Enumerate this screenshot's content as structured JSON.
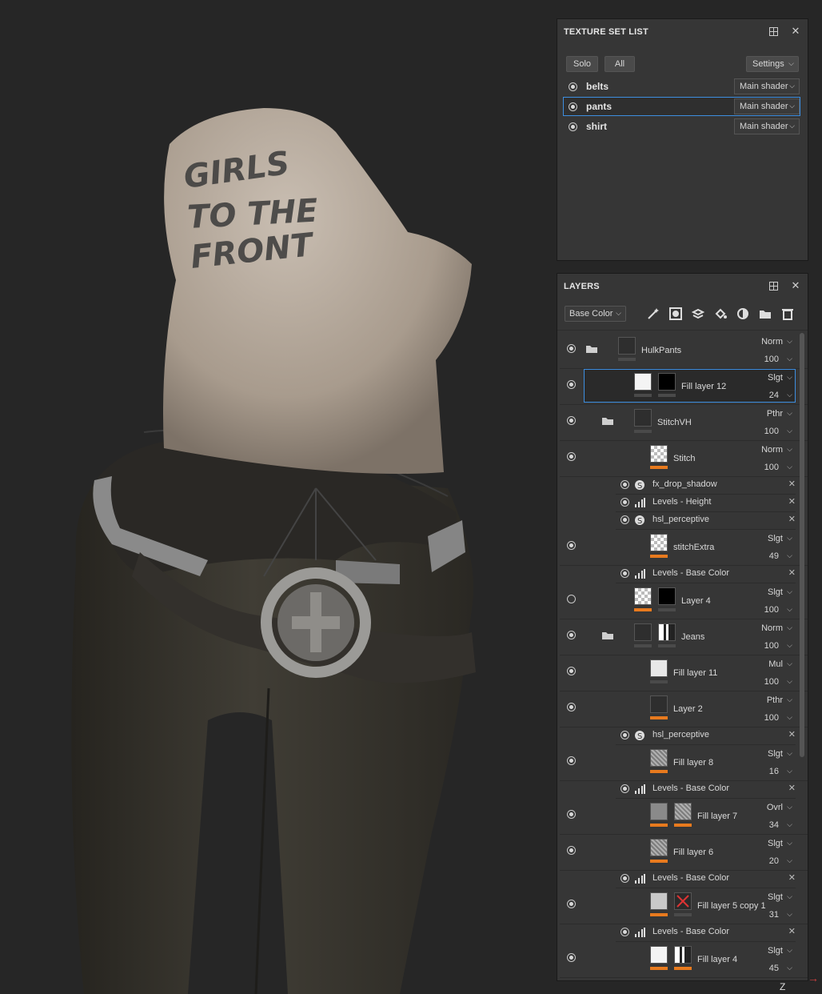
{
  "viewport": {
    "shirt_print_lines": [
      "GIRLS",
      "TO THE",
      "FRONT"
    ]
  },
  "texture_set_list": {
    "title": "TEXTURE SET LIST",
    "solo_label": "Solo",
    "all_label": "All",
    "settings_label": "Settings",
    "sets": [
      {
        "name": "belts",
        "shader": "Main shader",
        "selected": false
      },
      {
        "name": "pants",
        "shader": "Main shader",
        "selected": true
      },
      {
        "name": "shirt",
        "shader": "Main shader",
        "selected": false
      }
    ]
  },
  "layers_panel": {
    "title": "LAYERS",
    "channel": "Base Color",
    "layers": [
      {
        "name": "HulkPants",
        "blend": "Norm",
        "opacity": "100"
      },
      {
        "name": "Fill layer 12",
        "blend": "Slgt",
        "opacity": "24"
      },
      {
        "name": "StitchVH",
        "blend": "Pthr",
        "opacity": "100"
      },
      {
        "name": "Stitch",
        "blend": "Norm",
        "opacity": "100"
      },
      {
        "name": "stitchExtra",
        "blend": "Slgt",
        "opacity": "49"
      },
      {
        "name": "Layer 4",
        "blend": "Slgt",
        "opacity": "100"
      },
      {
        "name": "Jeans",
        "blend": "Norm",
        "opacity": "100"
      },
      {
        "name": "Fill layer 11",
        "blend": "Mul",
        "opacity": "100"
      },
      {
        "name": "Layer 2",
        "blend": "Pthr",
        "opacity": "100"
      },
      {
        "name": "Fill layer 8",
        "blend": "Slgt",
        "opacity": "16"
      },
      {
        "name": "Fill layer 7",
        "blend": "Ovrl",
        "opacity": "34"
      },
      {
        "name": "Fill layer 6",
        "blend": "Slgt",
        "opacity": "20"
      },
      {
        "name": "Fill layer 5 copy 1",
        "blend": "Slgt",
        "opacity": "31"
      },
      {
        "name": "Fill layer 4",
        "blend": "Slgt",
        "opacity": "45"
      }
    ],
    "effects": [
      {
        "name": "fx_drop_shadow",
        "icon": "substance-icon"
      },
      {
        "name": "Levels - Height",
        "icon": "levels-icon"
      },
      {
        "name": "hsl_perceptive",
        "icon": "substance-icon"
      },
      {
        "name": "Levels - Base Color",
        "icon": "levels-icon"
      },
      {
        "name": "hsl_perceptive",
        "icon": "substance-icon"
      },
      {
        "name": "Levels - Base Color",
        "icon": "levels-icon"
      },
      {
        "name": "Levels - Base Color",
        "icon": "levels-icon"
      },
      {
        "name": "Levels - Base Color",
        "icon": "levels-icon"
      }
    ]
  },
  "colors": {
    "accent_orange": "#e87a1e",
    "selection_blue": "#3d8ee0"
  }
}
